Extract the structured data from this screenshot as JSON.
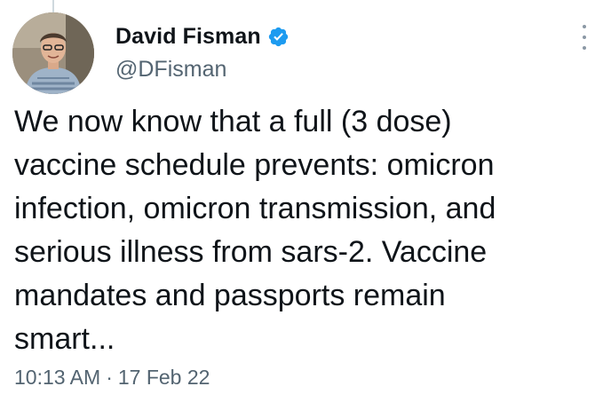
{
  "author": {
    "display_name": "David Fisman",
    "handle": "@DFisman",
    "verified_icon": "verified-badge-icon",
    "badge_color": "#1d9bf0"
  },
  "tweet": {
    "text": "We now know that a full (3 dose)\nvaccine schedule prevents: omicron\ninfection, omicron transmission, and\nserious illness from sars-2.  Vaccine\nmandates and passports remain\nsmart...",
    "time": "10:13 AM",
    "separator": "·",
    "date": "17 Feb 22"
  },
  "icons": {
    "more": "more-options-icon"
  }
}
